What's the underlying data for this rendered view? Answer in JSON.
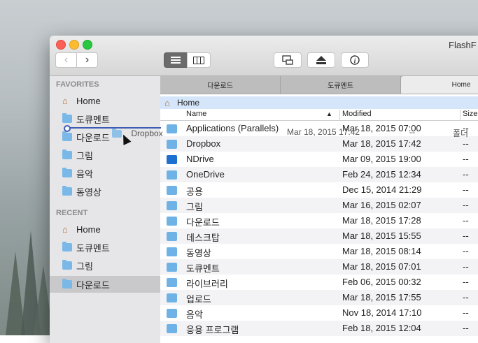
{
  "window": {
    "title": "FlashF"
  },
  "sidebar": {
    "favorites_heading": "FAVORITES",
    "favorites": [
      {
        "label": "Home",
        "icon": "home-icon"
      },
      {
        "label": "도큐멘트",
        "icon": "documents-folder-icon"
      },
      {
        "label": "다운로드",
        "icon": "downloads-folder-icon"
      },
      {
        "label": "그림",
        "icon": "pictures-folder-icon"
      },
      {
        "label": "음악",
        "icon": "music-folder-icon"
      },
      {
        "label": "동영상",
        "icon": "movies-folder-icon"
      }
    ],
    "recent_heading": "RECENT",
    "recent": [
      {
        "label": "Home",
        "icon": "home-icon"
      },
      {
        "label": "도큐멘트",
        "icon": "documents-folder-icon"
      },
      {
        "label": "그림",
        "icon": "pictures-folder-icon"
      },
      {
        "label": "다운로드",
        "icon": "downloads-folder-icon"
      }
    ]
  },
  "tabs": [
    "다운로드",
    "도큐멘트",
    "Home"
  ],
  "path": {
    "label": "Home"
  },
  "columns": {
    "name": "Name",
    "modified": "Modified",
    "size": "Size",
    "sort_indicator": "▲"
  },
  "files": [
    {
      "name": "Applications (Parallels)",
      "modified": "Mar 18, 2015 07:00",
      "size": "--",
      "color": "#6fb3e6"
    },
    {
      "name": "Dropbox",
      "modified": "Mar 18, 2015 17:42",
      "size": "--",
      "color": "#6fb3e6"
    },
    {
      "name": "NDrive",
      "modified": "Mar 09, 2015 19:00",
      "size": "--",
      "color": "#1f6fd0"
    },
    {
      "name": "OneDrive",
      "modified": "Feb 24, 2015 12:34",
      "size": "--",
      "color": "#6fb3e6"
    },
    {
      "name": "공용",
      "modified": "Dec 15, 2014 21:29",
      "size": "--",
      "color": "#6fb3e6"
    },
    {
      "name": "그림",
      "modified": "Mar 16, 2015 02:07",
      "size": "--",
      "color": "#6fb3e6"
    },
    {
      "name": "다운로드",
      "modified": "Mar 18, 2015 17:28",
      "size": "--",
      "color": "#6fb3e6"
    },
    {
      "name": "데스크탑",
      "modified": "Mar 18, 2015 15:55",
      "size": "--",
      "color": "#6fb3e6"
    },
    {
      "name": "동영상",
      "modified": "Mar 18, 2015 08:14",
      "size": "--",
      "color": "#6fb3e6"
    },
    {
      "name": "도큐멘트",
      "modified": "Mar 18, 2015 07:01",
      "size": "--",
      "color": "#6fb3e6"
    },
    {
      "name": "라이브러리",
      "modified": "Feb 06, 2015 00:32",
      "size": "--",
      "color": "#6fb3e6"
    },
    {
      "name": "업로드",
      "modified": "Mar 18, 2015 17:55",
      "size": "--",
      "color": "#6fb3e6"
    },
    {
      "name": "음악",
      "modified": "Nov 18, 2014 17:10",
      "size": "--",
      "color": "#6fb3e6"
    },
    {
      "name": "응용 프로그램",
      "modified": "Feb 18, 2015 12:04",
      "size": "--",
      "color": "#6fb3e6"
    }
  ],
  "drag_ghost": {
    "name": "Dropbox",
    "modified": "Mar 18, 2015 17:42",
    "size": "--",
    "kind": "폴더"
  }
}
